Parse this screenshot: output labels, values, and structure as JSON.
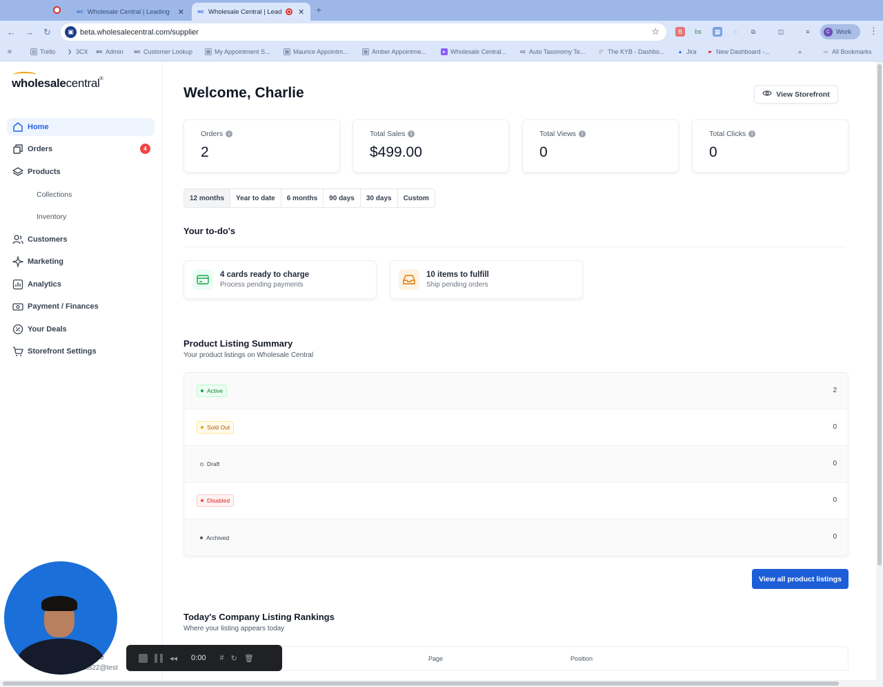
{
  "browser": {
    "tabs": [
      {
        "title": "Wholesale Central | Leading"
      },
      {
        "title": "Wholesale Central | Leadi"
      }
    ],
    "url": "beta.wholesalecentral.com/supplier",
    "profile": "Work",
    "bookmarks": [
      "Trello",
      "3CX",
      "Admin",
      "Customer Lookup",
      "My Appointment S...",
      "Maurice Appointm...",
      "Amber Appointme...",
      "Wholesale Central...",
      "Auto Taxonomy Te...",
      "The KYB - Dashbo...",
      "Jira",
      "New Dashboard -..."
    ],
    "all_bookmarks": "All Bookmarks"
  },
  "sidebar": {
    "logo_bold": "wholesale",
    "logo_light": "central",
    "logo_reg": "®",
    "items": [
      {
        "label": "Home",
        "icon": "home-icon"
      },
      {
        "label": "Orders",
        "icon": "orders-icon",
        "badge": "4"
      },
      {
        "label": "Products",
        "icon": "layers-icon"
      },
      {
        "label": "Collections"
      },
      {
        "label": "Inventory"
      },
      {
        "label": "Customers",
        "icon": "users-icon"
      },
      {
        "label": "Marketing",
        "icon": "sparkle-icon"
      },
      {
        "label": "Analytics",
        "icon": "chart-icon"
      },
      {
        "label": "Payment / Finances",
        "icon": "money-icon"
      },
      {
        "label": "Your Deals",
        "icon": "percent-icon"
      },
      {
        "label": "Storefront Settings",
        "icon": "cart-icon"
      }
    ],
    "user_name_fragment": "e",
    "user_email_fragment": "st822@test"
  },
  "main": {
    "welcome": "Welcome, Charlie",
    "view_storefront": "View Storefront",
    "stats": [
      {
        "label": "Orders",
        "value": "2"
      },
      {
        "label": "Total Sales",
        "value": "$499.00"
      },
      {
        "label": "Total Views",
        "value": "0"
      },
      {
        "label": "Total Clicks",
        "value": "0"
      }
    ],
    "ranges": [
      "12 months",
      "Year to date",
      "6 months",
      "90 days",
      "30 days",
      "Custom"
    ],
    "selected_range": "12 months",
    "todos_title": "Your to-do's",
    "todos": [
      {
        "title": "4 cards ready to charge",
        "subtitle": "Process pending payments",
        "icon": "card-icon"
      },
      {
        "title": "10 items to fulfill",
        "subtitle": "Ship pending orders",
        "icon": "inbox-icon"
      }
    ],
    "listing_summary": {
      "title": "Product Listing Summary",
      "subtitle": "Your product listings on Wholesale Central",
      "rows": [
        {
          "status": "Active",
          "count": "2"
        },
        {
          "status": "Sold Out",
          "count": "0"
        },
        {
          "status": "Draft",
          "count": "0"
        },
        {
          "status": "Disabled",
          "count": "0"
        },
        {
          "status": "Archived",
          "count": "0"
        }
      ],
      "view_all": "View all product listings"
    },
    "rankings": {
      "title": "Today's Company Listing Rankings",
      "subtitle": "Where your listing appears today",
      "columns": [
        "Page",
        "Position"
      ]
    }
  },
  "recorder": {
    "time": "0:00"
  }
}
